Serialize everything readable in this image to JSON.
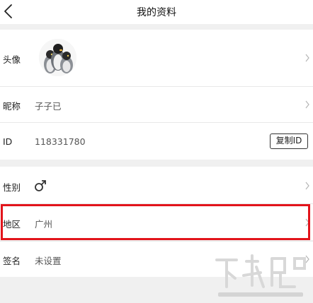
{
  "header": {
    "title": "我的资料",
    "back_icon": "chevron-left-icon"
  },
  "profile": {
    "avatar_label": "头像",
    "nickname_label": "昵称",
    "nickname_value": "子子已",
    "id_label": "ID",
    "id_value": "118331780",
    "copy_id_label": "复制ID",
    "gender_label": "性别",
    "gender_icon": "male-symbol-icon",
    "region_label": "地区",
    "region_value": "广州",
    "signature_label": "签名",
    "signature_value": "未设置"
  },
  "colors": {
    "highlight_border": "#e2141b",
    "background": "#f0f0f0",
    "row_background": "#ffffff"
  }
}
